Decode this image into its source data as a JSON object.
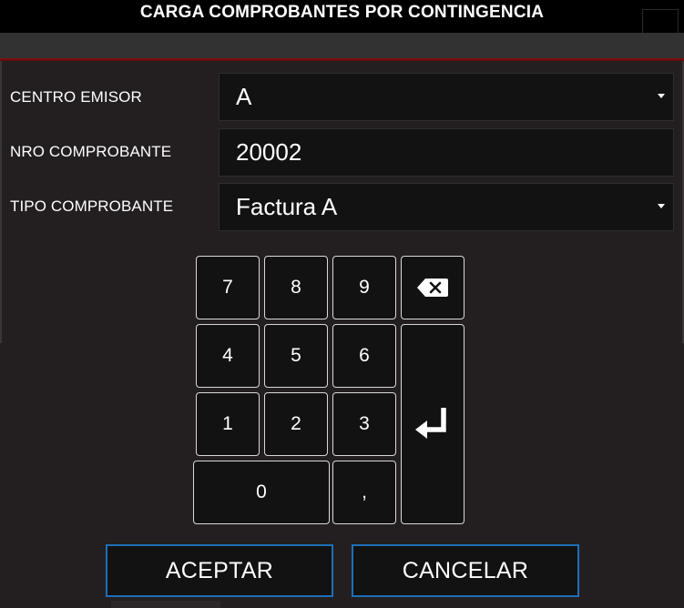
{
  "window": {
    "title": "CARGA COMPROBANTES POR CONTINGENCIA"
  },
  "form": {
    "centro_emisor": {
      "label": "CENTRO EMISOR",
      "value": "A"
    },
    "nro_comprobante": {
      "label": "NRO COMPROBANTE",
      "value": "20002"
    },
    "tipo_comprobante": {
      "label": "TIPO COMPROBANTE",
      "value": "Factura A"
    }
  },
  "keypad": {
    "k7": "7",
    "k8": "8",
    "k9": "9",
    "k4": "4",
    "k5": "5",
    "k6": "6",
    "k1": "1",
    "k2": "2",
    "k3": "3",
    "k0": "0",
    "comma": ",",
    "backspace_icon": "backspace-icon",
    "enter_icon": "enter-icon"
  },
  "buttons": {
    "accept": "ACEPTAR",
    "cancel": "CANCELAR"
  },
  "colors": {
    "accent_border": "#1e6fb8",
    "header_line": "#8a1010",
    "background": "#231f20"
  }
}
